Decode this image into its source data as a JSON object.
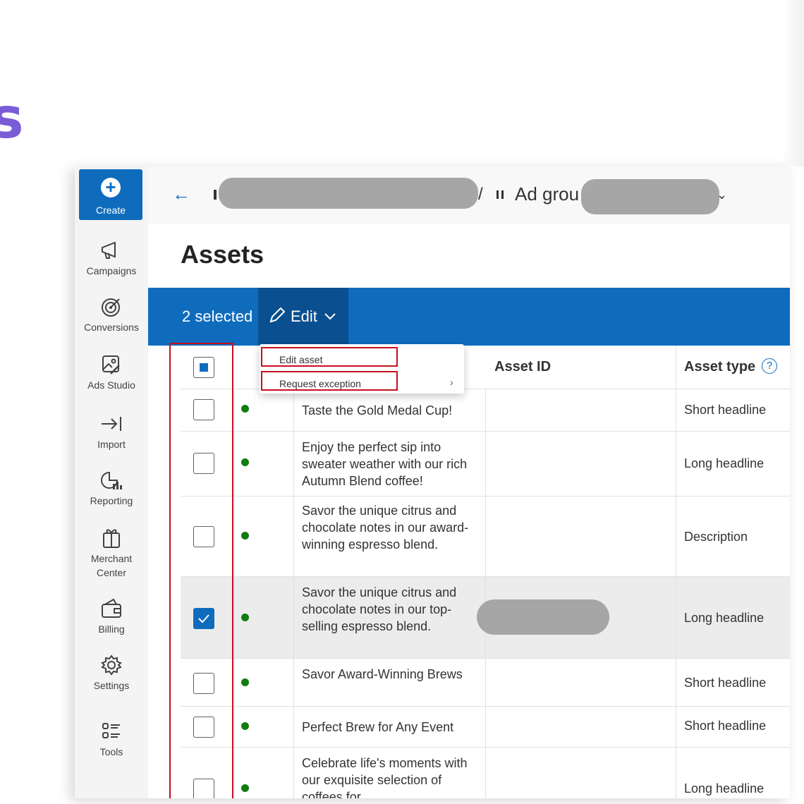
{
  "heading_glyph": "s",
  "sidebar": {
    "create_label": "Create",
    "items": [
      {
        "label": "Campaigns",
        "icon": "megaphone-icon"
      },
      {
        "label": "Conversions",
        "icon": "target-icon"
      },
      {
        "label": "Ads Studio",
        "icon": "image-edit-icon"
      },
      {
        "label": "Import",
        "icon": "arrow-to-bar-icon"
      },
      {
        "label": "Reporting",
        "icon": "chart-pie-icon"
      },
      {
        "label": "Merchant Center",
        "icon": "gift-icon"
      },
      {
        "label": "Billing",
        "icon": "wallet-icon"
      },
      {
        "label": "Settings",
        "icon": "gear-icon"
      },
      {
        "label": "Tools",
        "icon": "list-tools-icon"
      }
    ]
  },
  "breadcrumb": {
    "separator": "/",
    "ad_group_label": "Ad grou"
  },
  "page": {
    "title": "Assets"
  },
  "selection_bar": {
    "count_label": "2 selected",
    "edit_label": "Edit"
  },
  "edit_menu": {
    "items": [
      "Edit asset",
      "Request exception"
    ]
  },
  "table": {
    "headers": {
      "asset_id": "Asset ID",
      "asset_type": "Asset type"
    },
    "rows": [
      {
        "text": "Taste the Gold Medal Cup!",
        "type": "Short headline",
        "checked": false
      },
      {
        "text": "Enjoy the perfect sip into sweater weather with our rich Autumn Blend coffee!",
        "type": "Long headline",
        "checked": false
      },
      {
        "text": "Savor the unique citrus and chocolate notes in our award-winning espresso blend.",
        "type": "Description",
        "checked": false
      },
      {
        "text": "Savor the unique citrus and chocolate notes in our top-selling espresso blend.",
        "type": "Long headline",
        "checked": true
      },
      {
        "text": "Savor Award-Winning Brews",
        "type": "Short headline",
        "checked": false
      },
      {
        "text": "Perfect Brew for Any Event",
        "type": "Short headline",
        "checked": false
      },
      {
        "text": "Celebrate life's moments with our exquisite selection of coffees for",
        "type": "Long headline",
        "checked": false
      }
    ]
  },
  "colors": {
    "accent": "#0f6cbd",
    "status_active": "#107c10",
    "highlight": "#c50f1f"
  }
}
